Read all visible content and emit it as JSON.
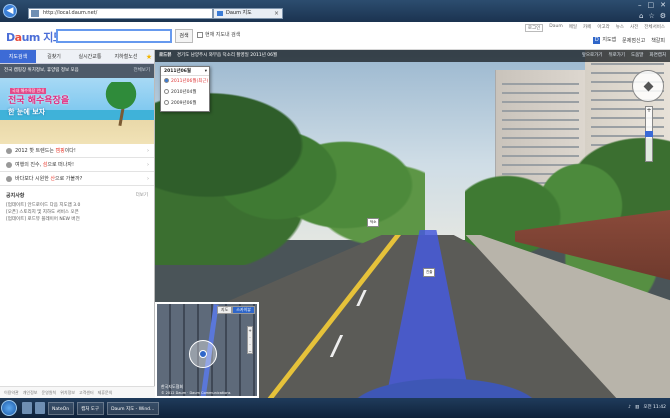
{
  "browser": {
    "back_icon": "back-arrow-icon",
    "address": "http://local.daum.net/",
    "tab_title": "Daum 지도",
    "window_buttons": [
      "–",
      "□",
      "✕"
    ],
    "toolbar_icons": [
      "⌂",
      "☆",
      "⚙"
    ]
  },
  "header": {
    "logo_prefix": "D",
    "logo_o": "a",
    "logo_suffix": "um",
    "logo_map": "지도",
    "search_value": "",
    "search_button": "검색",
    "checkbox_label": "현재 지도내 검색",
    "top_links": [
      "로그인",
      "Daum",
      "메일",
      "카페",
      "아고라",
      "뉴스",
      "사전",
      "전체서비스"
    ],
    "sub_links": [
      "지도앱",
      "문제점신고",
      "책갈피"
    ]
  },
  "sidebar": {
    "tabs": [
      "지도검색",
      "길찾기",
      "실시간교통",
      "지하철노선"
    ],
    "sub_bar": "전국 캠핑장 위치정보, 휴양림 정보 모음",
    "sub_more": "전체보기",
    "banner": {
      "small": "국내 해수욕장 안내",
      "title": "전국 해수욕장을",
      "title2": "한 눈에 보자"
    },
    "rows": [
      {
        "pre": "2012 핫 트렌드는 ",
        "hl": "캠핑",
        "post": "이다!"
      },
      {
        "pre": "여행의 진수, ",
        "hl": "섬",
        "post": "으로 떠나자!"
      },
      {
        "pre": "바다보다 시원한 ",
        "hl": "산",
        "post": "으로 가볼까?"
      }
    ],
    "notice": {
      "title": "공지사항",
      "more": "더보기",
      "items": [
        "[업데이트] 안드로이드 다음 지도앱 3.0",
        "[오픈] 스토리지 및 지하도 서비스 오픈",
        "[업데이트] 로드뷰 플레이어 NEW 버전"
      ]
    },
    "footer": [
      "이용약관",
      "개인정보",
      "운영원칙",
      "위치정보",
      "고객센터",
      "제휴문의"
    ]
  },
  "streetview": {
    "topbar_strong": "로드뷰",
    "topbar_text": "경기도 남양주시 와부읍 덕소리 촬영일 2011년 06월",
    "right_links": [
      "앞으로가기",
      "뒤로가기",
      "도움말",
      "화면캡처"
    ],
    "date_popup": {
      "header": "2011년06월",
      "close": "▾",
      "options": [
        "2011년06월(최근)",
        "2010년04월",
        "2009년06월"
      ],
      "selected_index": 0
    },
    "signs": [
      "덕소",
      "진출"
    ],
    "minimap": {
      "tabs": [
        "지도",
        "스카이뷰"
      ],
      "label": "한국지도협회",
      "footer": "© 2012 Daum · Daum Communications"
    }
  },
  "taskbar": {
    "windows": [
      "Daum 지도 - Wind...",
      "캡처 도구",
      "NateOn"
    ],
    "clock": "오전 11:42"
  },
  "colors": {
    "accent": "#3d6bd6",
    "highlight": "#e93b2e",
    "route": "#4a5ad6"
  }
}
